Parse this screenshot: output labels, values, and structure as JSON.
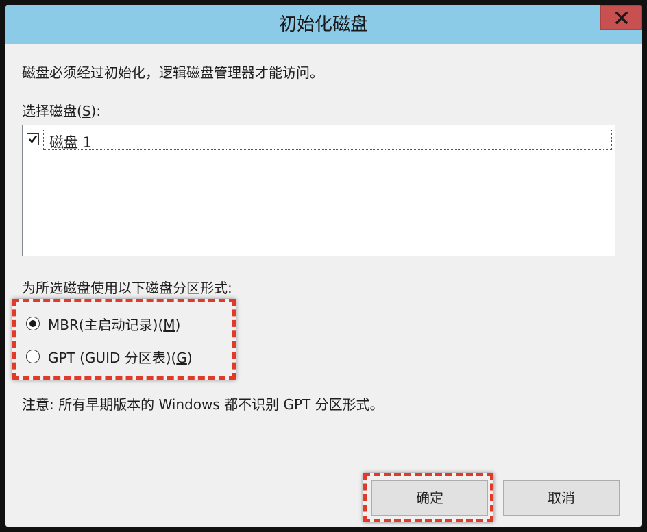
{
  "window": {
    "title": "初始化磁盘",
    "close_label": "X"
  },
  "intro_text": "磁盘必须经过初始化，逻辑磁盘管理器才能访问。",
  "select_disk": {
    "label_prefix": "选择磁盘(",
    "label_key": "S",
    "label_suffix": "):",
    "items": [
      {
        "label": "磁盘 1",
        "checked": true
      }
    ]
  },
  "partition": {
    "label": "为所选磁盘使用以下磁盘分区形式:",
    "options": [
      {
        "prefix": "MBR(主启动记录)(",
        "key": "M",
        "suffix": ")",
        "selected": true
      },
      {
        "prefix": "GPT (GUID 分区表)(",
        "key": "G",
        "suffix": ")",
        "selected": false
      }
    ]
  },
  "note": "注意: 所有早期版本的 Windows 都不识别 GPT 分区形式。",
  "buttons": {
    "ok": "确定",
    "cancel": "取消"
  },
  "colors": {
    "titlebar": "#8ccbe8",
    "close": "#c75050",
    "highlight": "#e23a2a"
  }
}
